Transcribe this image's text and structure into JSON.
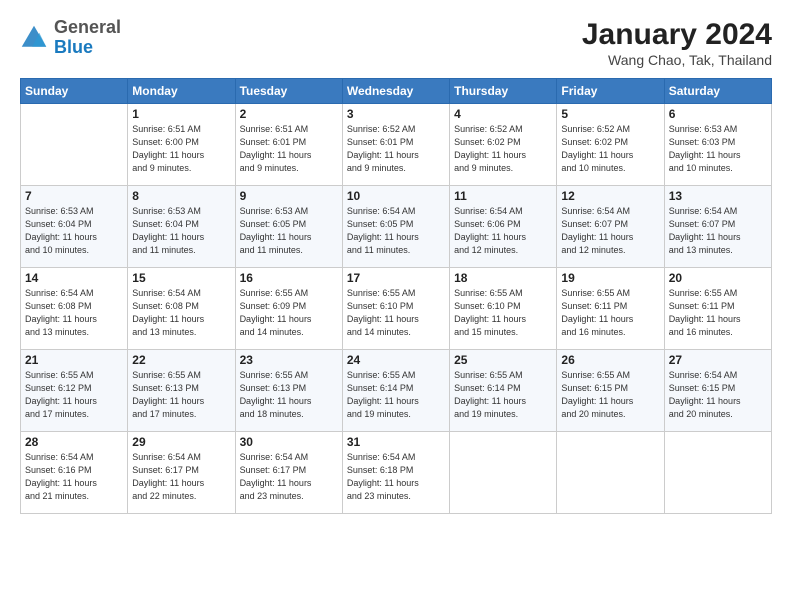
{
  "header": {
    "logo_general": "General",
    "logo_blue": "Blue",
    "title": "January 2024",
    "subtitle": "Wang Chao, Tak, Thailand"
  },
  "weekdays": [
    "Sunday",
    "Monday",
    "Tuesday",
    "Wednesday",
    "Thursday",
    "Friday",
    "Saturday"
  ],
  "weeks": [
    [
      {
        "day": "",
        "text": ""
      },
      {
        "day": "1",
        "text": "Sunrise: 6:51 AM\nSunset: 6:00 PM\nDaylight: 11 hours\nand 9 minutes."
      },
      {
        "day": "2",
        "text": "Sunrise: 6:51 AM\nSunset: 6:01 PM\nDaylight: 11 hours\nand 9 minutes."
      },
      {
        "day": "3",
        "text": "Sunrise: 6:52 AM\nSunset: 6:01 PM\nDaylight: 11 hours\nand 9 minutes."
      },
      {
        "day": "4",
        "text": "Sunrise: 6:52 AM\nSunset: 6:02 PM\nDaylight: 11 hours\nand 9 minutes."
      },
      {
        "day": "5",
        "text": "Sunrise: 6:52 AM\nSunset: 6:02 PM\nDaylight: 11 hours\nand 10 minutes."
      },
      {
        "day": "6",
        "text": "Sunrise: 6:53 AM\nSunset: 6:03 PM\nDaylight: 11 hours\nand 10 minutes."
      }
    ],
    [
      {
        "day": "7",
        "text": "Sunrise: 6:53 AM\nSunset: 6:04 PM\nDaylight: 11 hours\nand 10 minutes."
      },
      {
        "day": "8",
        "text": "Sunrise: 6:53 AM\nSunset: 6:04 PM\nDaylight: 11 hours\nand 11 minutes."
      },
      {
        "day": "9",
        "text": "Sunrise: 6:53 AM\nSunset: 6:05 PM\nDaylight: 11 hours\nand 11 minutes."
      },
      {
        "day": "10",
        "text": "Sunrise: 6:54 AM\nSunset: 6:05 PM\nDaylight: 11 hours\nand 11 minutes."
      },
      {
        "day": "11",
        "text": "Sunrise: 6:54 AM\nSunset: 6:06 PM\nDaylight: 11 hours\nand 12 minutes."
      },
      {
        "day": "12",
        "text": "Sunrise: 6:54 AM\nSunset: 6:07 PM\nDaylight: 11 hours\nand 12 minutes."
      },
      {
        "day": "13",
        "text": "Sunrise: 6:54 AM\nSunset: 6:07 PM\nDaylight: 11 hours\nand 13 minutes."
      }
    ],
    [
      {
        "day": "14",
        "text": "Sunrise: 6:54 AM\nSunset: 6:08 PM\nDaylight: 11 hours\nand 13 minutes."
      },
      {
        "day": "15",
        "text": "Sunrise: 6:54 AM\nSunset: 6:08 PM\nDaylight: 11 hours\nand 13 minutes."
      },
      {
        "day": "16",
        "text": "Sunrise: 6:55 AM\nSunset: 6:09 PM\nDaylight: 11 hours\nand 14 minutes."
      },
      {
        "day": "17",
        "text": "Sunrise: 6:55 AM\nSunset: 6:10 PM\nDaylight: 11 hours\nand 14 minutes."
      },
      {
        "day": "18",
        "text": "Sunrise: 6:55 AM\nSunset: 6:10 PM\nDaylight: 11 hours\nand 15 minutes."
      },
      {
        "day": "19",
        "text": "Sunrise: 6:55 AM\nSunset: 6:11 PM\nDaylight: 11 hours\nand 16 minutes."
      },
      {
        "day": "20",
        "text": "Sunrise: 6:55 AM\nSunset: 6:11 PM\nDaylight: 11 hours\nand 16 minutes."
      }
    ],
    [
      {
        "day": "21",
        "text": "Sunrise: 6:55 AM\nSunset: 6:12 PM\nDaylight: 11 hours\nand 17 minutes."
      },
      {
        "day": "22",
        "text": "Sunrise: 6:55 AM\nSunset: 6:13 PM\nDaylight: 11 hours\nand 17 minutes."
      },
      {
        "day": "23",
        "text": "Sunrise: 6:55 AM\nSunset: 6:13 PM\nDaylight: 11 hours\nand 18 minutes."
      },
      {
        "day": "24",
        "text": "Sunrise: 6:55 AM\nSunset: 6:14 PM\nDaylight: 11 hours\nand 19 minutes."
      },
      {
        "day": "25",
        "text": "Sunrise: 6:55 AM\nSunset: 6:14 PM\nDaylight: 11 hours\nand 19 minutes."
      },
      {
        "day": "26",
        "text": "Sunrise: 6:55 AM\nSunset: 6:15 PM\nDaylight: 11 hours\nand 20 minutes."
      },
      {
        "day": "27",
        "text": "Sunrise: 6:54 AM\nSunset: 6:15 PM\nDaylight: 11 hours\nand 20 minutes."
      }
    ],
    [
      {
        "day": "28",
        "text": "Sunrise: 6:54 AM\nSunset: 6:16 PM\nDaylight: 11 hours\nand 21 minutes."
      },
      {
        "day": "29",
        "text": "Sunrise: 6:54 AM\nSunset: 6:17 PM\nDaylight: 11 hours\nand 22 minutes."
      },
      {
        "day": "30",
        "text": "Sunrise: 6:54 AM\nSunset: 6:17 PM\nDaylight: 11 hours\nand 23 minutes."
      },
      {
        "day": "31",
        "text": "Sunrise: 6:54 AM\nSunset: 6:18 PM\nDaylight: 11 hours\nand 23 minutes."
      },
      {
        "day": "",
        "text": ""
      },
      {
        "day": "",
        "text": ""
      },
      {
        "day": "",
        "text": ""
      }
    ]
  ]
}
